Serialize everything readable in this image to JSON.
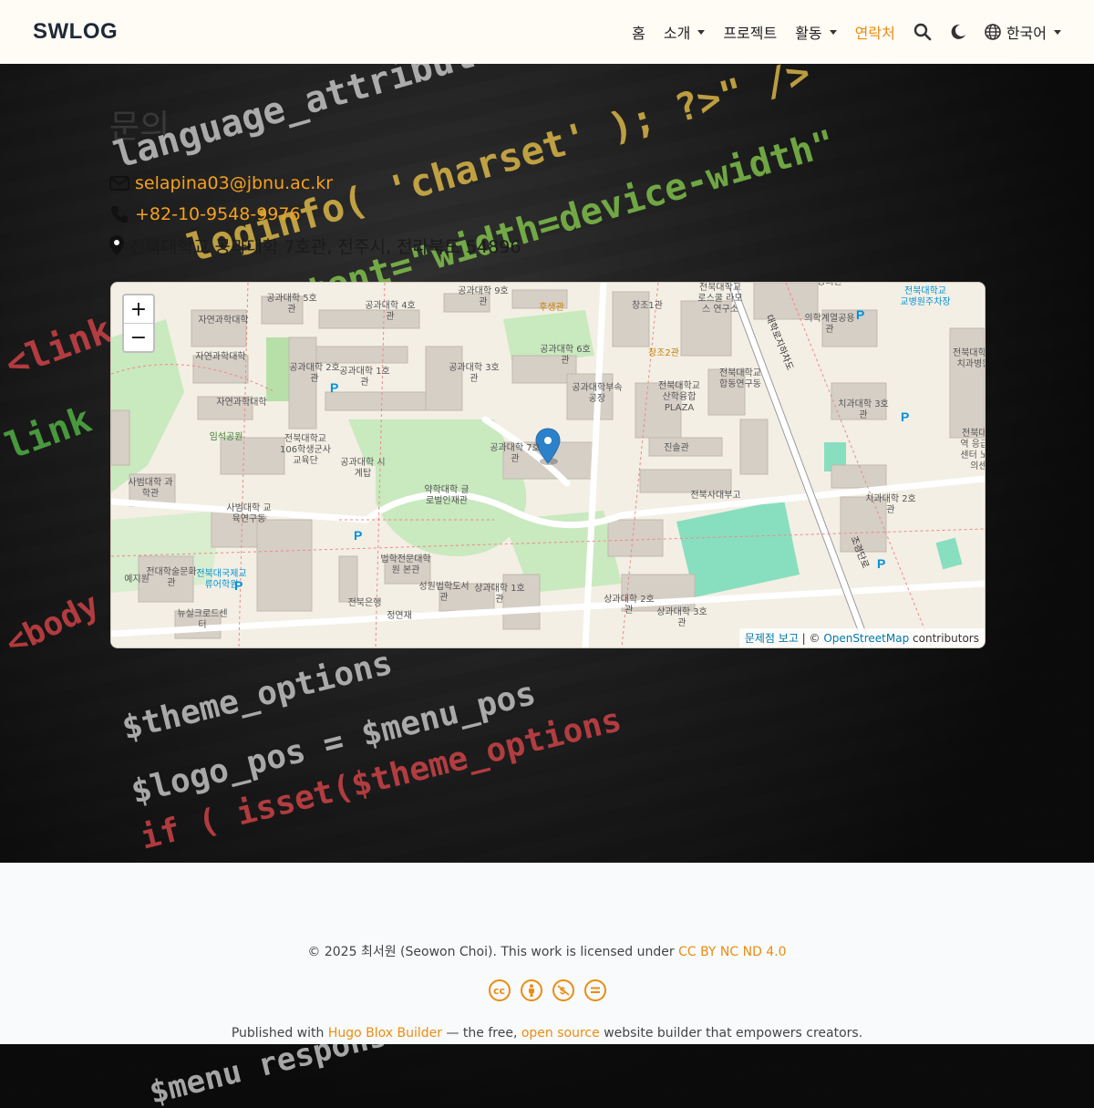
{
  "brand": "SWLOG",
  "nav": {
    "home": "홈",
    "about": "소개",
    "projects": "프로젝트",
    "activities": "활동",
    "contact": "연락처",
    "language": "한국어"
  },
  "contact": {
    "heading": "문의",
    "email": "selapina03@jbnu.ac.kr",
    "phone": "+82-10-9548-9976",
    "address": "전북대학교 공과대학 7호관, 전주시, 전라북도 54896"
  },
  "map": {
    "zoom_in": "+",
    "zoom_out": "−",
    "attribution_report": "문제점 보고",
    "attribution_sep": " | © ",
    "attribution_osm": "OpenStreetMap",
    "attribution_tail": " contributors",
    "labels": [
      "공과대학 5호관",
      "공과대학 4호관",
      "공과대학 9호관",
      "후생관",
      "창조1관",
      "전북대학교 로스쿨 라모스 연구소",
      "장의관",
      "전북대학교 교병원주차장",
      "자연과학대학",
      "자연과학대학",
      "공과대학 2호관",
      "공과대학 1호관",
      "공과대학 3호관",
      "공과대학 6호관",
      "창조2관",
      "의학계열공용관",
      "전북대학교 치과병원",
      "자연과학대학",
      "공과대학부속공장",
      "전북대학교 산학융합 PLAZA",
      "전북대학교 합동연구동",
      "대학로지하차도",
      "치과대학 3호관",
      "임석공원",
      "전북대학교 106학생군사교육단",
      "공과대학 시계탑",
      "공과대학 7호관",
      "진솔관",
      "전북대학교 역 응급의료센터 노인건의센터",
      "사범대학 과학관",
      "약학대학 글로벌인재관",
      "전북사대부고",
      "치과대학 2호관",
      "사범대학 교육연구동",
      "조경단로",
      "전대학술문화관",
      "법학전문대학원 본관",
      "성원법학도서관",
      "상과대학 1호관",
      "상과대학 2호관",
      "상과대학 3호관",
      "전북대국제교류어학원",
      "뉴실크로드센터",
      "전북은행",
      "정연재",
      "예지원"
    ]
  },
  "footer": {
    "copy_prefix": "© 2025 최서원 (Seowon Choi). This work is licensed under ",
    "license": "CC BY NC ND 4.0",
    "pub_prefix": "Published with ",
    "hugo": "Hugo Blox Builder",
    "pub_mid": " — the free, ",
    "opensource": "open source",
    "pub_suffix": " website builder that empowers creators."
  },
  "colors": {
    "accent": "#ec8c0f",
    "link": "#f6a11c",
    "navbar_bg": "#fffbf5",
    "footer_bg": "#f8fafc"
  }
}
